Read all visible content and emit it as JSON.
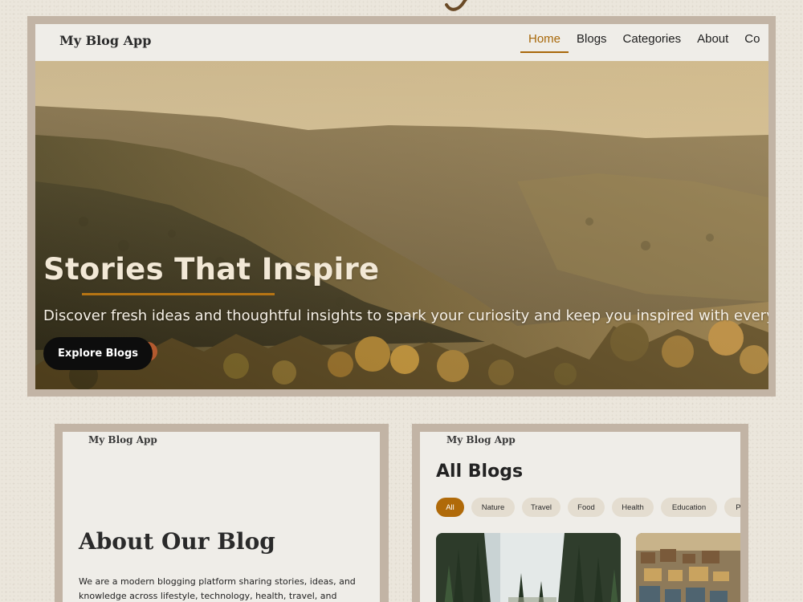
{
  "app": {
    "title": "My Blog App"
  },
  "nav": {
    "items": [
      {
        "label": "Home",
        "active": true
      },
      {
        "label": "Blogs"
      },
      {
        "label": "Categories"
      },
      {
        "label": "About"
      },
      {
        "label": "Co"
      }
    ]
  },
  "hero": {
    "title": "Stories That Inspire",
    "subtitle": "Discover fresh ideas and thoughtful insights to spark your curiosity and keep you inspired with every r",
    "cta_label": "Explore Blogs"
  },
  "about_page": {
    "logo": "My Blog App",
    "title": "About Our Blog",
    "body": "We are a modern blogging platform sharing stories, ideas, and knowledge across lifestyle, technology, health, travel, and education."
  },
  "blogs_page": {
    "logo": "My Blog App",
    "title": "All Blogs",
    "filters": [
      {
        "label": "All",
        "active": true
      },
      {
        "label": "Nature"
      },
      {
        "label": "Travel"
      },
      {
        "label": "Food"
      },
      {
        "label": "Health"
      },
      {
        "label": "Education"
      },
      {
        "label": "Ph"
      }
    ]
  },
  "colors": {
    "accent": "#a8680a",
    "frame": "#c2b4a5",
    "background": "#ebe6dc",
    "navbar": "#efede8",
    "button": "#0d0d0d"
  },
  "icons": [
    "decorative-flourish-icon"
  ]
}
